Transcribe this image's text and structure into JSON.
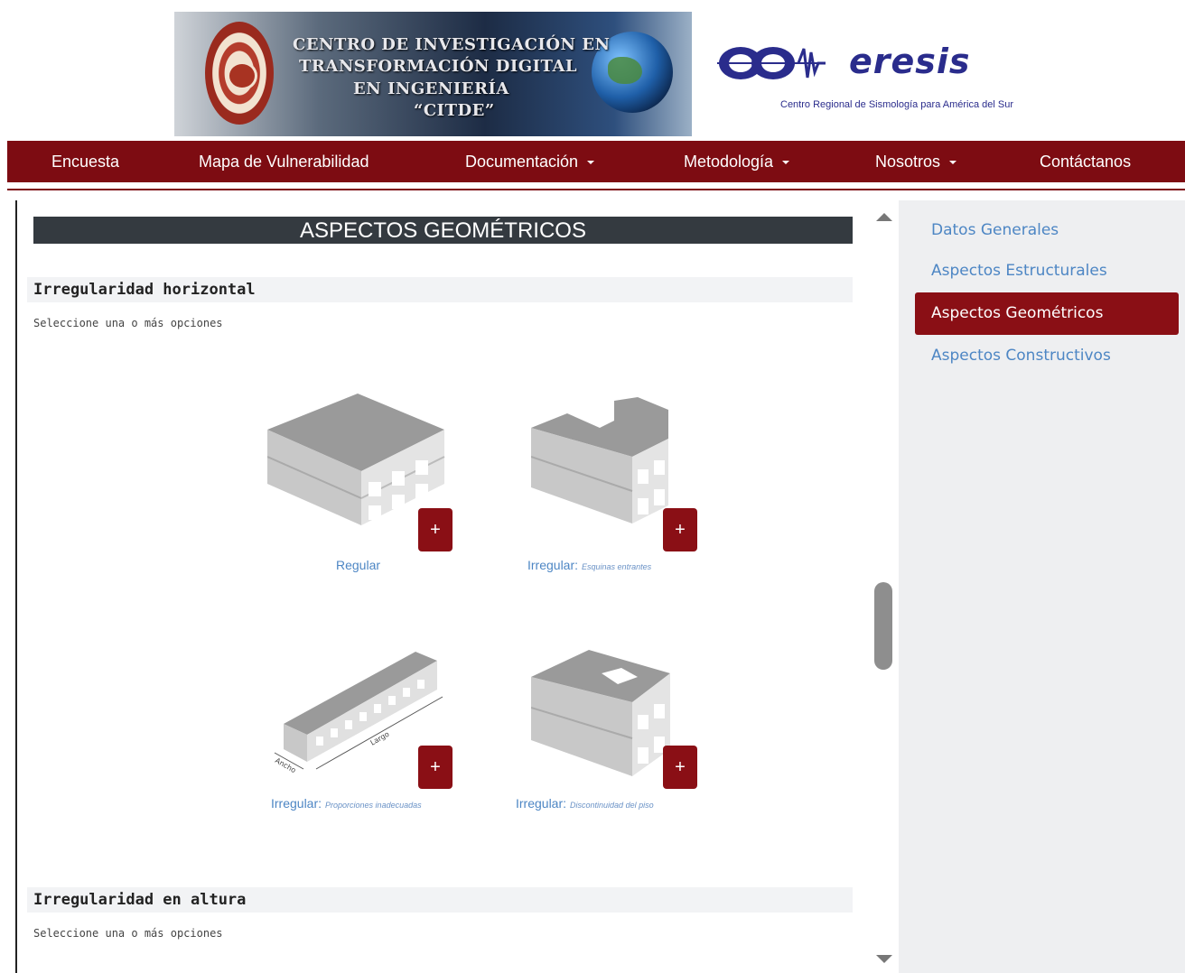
{
  "header": {
    "banner_lines": [
      "CENTRO DE INVESTIGACIÓN EN",
      "TRANSFORMACIÓN DIGITAL",
      "EN INGENIERÍA",
      "“CITDE”"
    ],
    "ceresis_logo": "eresis",
    "ceresis_subtitle": "Centro Regional de Sismología para América del Sur"
  },
  "navbar": {
    "items": [
      {
        "label": "Encuesta"
      },
      {
        "label": "Mapa de Vulnerabilidad"
      },
      {
        "label": "Documentación"
      },
      {
        "label": "Metodología"
      },
      {
        "label": "Nosotros"
      },
      {
        "label": "Contáctanos"
      }
    ]
  },
  "main": {
    "title": "ASPECTOS GEOMÉTRICOS",
    "sections": [
      {
        "heading": "Irregularidad horizontal",
        "subtitle": "Seleccione una o más opciones",
        "options": [
          {
            "label": "Regular",
            "detail": "",
            "button": "+"
          },
          {
            "label": "Irregular:",
            "detail": "Esquinas entrantes",
            "button": "+"
          },
          {
            "label": "Irregular:",
            "detail": "Proporciones inadecuadas",
            "button": "+",
            "diagram_labels": [
              "Largo",
              "Ancho"
            ]
          },
          {
            "label": "Irregular:",
            "detail": "Discontinuidad del piso",
            "button": "+"
          }
        ]
      },
      {
        "heading": "Irregularidad en altura",
        "subtitle": "Seleccione una o más opciones"
      }
    ]
  },
  "sidebar": {
    "items": [
      {
        "label": "Datos Generales",
        "active": false
      },
      {
        "label": "Aspectos Estructurales",
        "active": false
      },
      {
        "label": "Aspectos Geométricos",
        "active": true
      },
      {
        "label": "Aspectos Constructivos",
        "active": false
      }
    ]
  },
  "colors": {
    "brand": "#7d0c12",
    "title_bar": "#343a40",
    "link": "#4d86c4"
  }
}
